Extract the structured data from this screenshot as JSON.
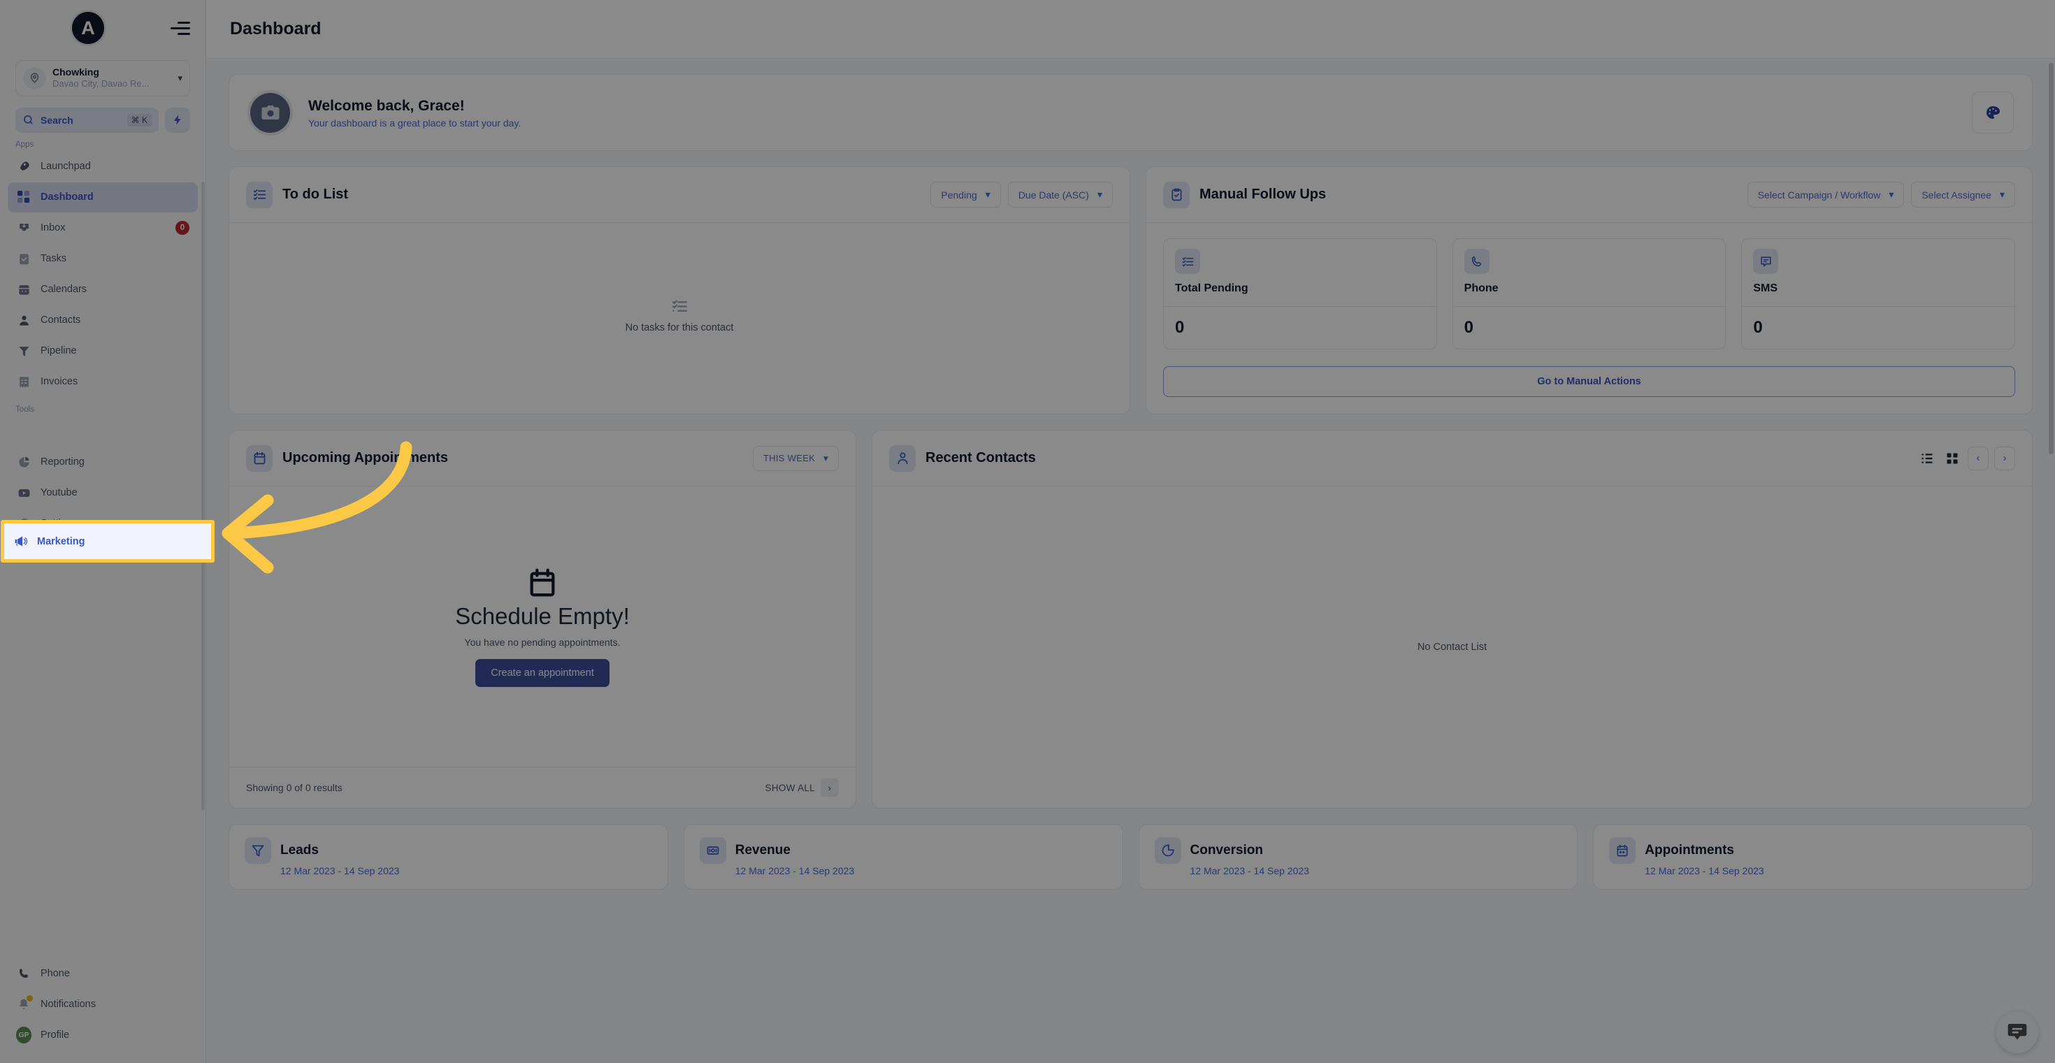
{
  "brand": {
    "logo_letter": "A",
    "accent": "#3b55c4",
    "highlight": "#fbc945"
  },
  "sidebar": {
    "location": {
      "name": "Chowking",
      "subtitle": "Davao City, Davao Re...",
      "icon": "map-pin-icon"
    },
    "search": {
      "label": "Search",
      "shortcut": "⌘ K",
      "icon": "search-icon"
    },
    "quick_action_icon": "lightning-bolt-icon",
    "sections": [
      {
        "label": "Apps",
        "items": [
          {
            "label": "Launchpad",
            "icon": "rocket-icon",
            "active": false
          },
          {
            "label": "Dashboard",
            "icon": "grid-icon",
            "active": true
          },
          {
            "label": "Inbox",
            "icon": "inbox-icon",
            "active": false,
            "badge": "0"
          },
          {
            "label": "Tasks",
            "icon": "clipboard-check-icon",
            "active": false
          },
          {
            "label": "Calendars",
            "icon": "calendar-icon",
            "active": false
          },
          {
            "label": "Contacts",
            "icon": "user-icon",
            "active": false
          },
          {
            "label": "Pipeline",
            "icon": "funnel-icon",
            "active": false
          },
          {
            "label": "Invoices",
            "icon": "receipt-icon",
            "active": false
          }
        ]
      },
      {
        "label": "Tools",
        "items": [
          {
            "label": "Marketing",
            "icon": "megaphone-icon",
            "active": false,
            "highlighted": true
          },
          {
            "label": "Reporting",
            "icon": "pie-chart-icon",
            "active": false
          },
          {
            "label": "Youtube",
            "icon": "youtube-icon",
            "active": false
          },
          {
            "label": "Settings",
            "icon": "gear-icon",
            "active": false
          }
        ]
      }
    ],
    "footer": [
      {
        "label": "Phone",
        "icon": "phone-icon"
      },
      {
        "label": "Notifications",
        "icon": "bell-icon",
        "dot": true
      },
      {
        "label": "Profile",
        "icon": "avatar",
        "initials": "GP"
      }
    ]
  },
  "header": {
    "title": "Dashboard",
    "menu_icon": "hamburger-icon"
  },
  "welcome": {
    "title": "Welcome back, Grace!",
    "subtitle": "Your dashboard is a great place to start your day.",
    "avatar_icon": "camera-icon",
    "theme_button_icon": "palette-icon"
  },
  "todo": {
    "title": "To do List",
    "icon": "checklist-icon",
    "filters": [
      {
        "label": "Pending",
        "icon": "chevron-down-icon"
      },
      {
        "label": "Due Date (ASC)",
        "icon": "chevron-down-icon"
      }
    ],
    "empty_text": "No tasks for this contact",
    "empty_icon": "checklist-icon"
  },
  "follow_ups": {
    "title": "Manual Follow Ups",
    "icon": "clipboard-check-icon",
    "filters": [
      {
        "label": "Select Campaign / Workflow",
        "icon": "chevron-down-icon"
      },
      {
        "label": "Select Assignee",
        "icon": "chevron-down-icon"
      }
    ],
    "stats": [
      {
        "name": "Total Pending",
        "value": "0",
        "icon": "checklist-icon"
      },
      {
        "name": "Phone",
        "value": "0",
        "icon": "phone-icon"
      },
      {
        "name": "SMS",
        "value": "0",
        "icon": "sms-icon"
      }
    ],
    "action_label": "Go to Manual Actions"
  },
  "appointments": {
    "title": "Upcoming Appointments",
    "icon": "calendar-icon",
    "filter": {
      "label": "THIS WEEK",
      "icon": "chevron-down-icon"
    },
    "empty_icon": "calendar-icon",
    "empty_title": "Schedule Empty!",
    "empty_subtitle": "You have no pending appointments.",
    "cta_label": "Create an appointment",
    "results_text": "Showing 0 of 0 results",
    "show_all_label": "SHOW ALL",
    "show_all_icon": "chevron-right-icon"
  },
  "recent_contacts": {
    "title": "Recent Contacts",
    "icon": "user-icon",
    "view_list_icon": "list-view-icon",
    "view_grid_icon": "grid-view-icon",
    "prev_icon": "chevron-left-icon",
    "next_icon": "chevron-right-icon",
    "empty_text": "No Contact List"
  },
  "metrics": [
    {
      "title": "Leads",
      "date_range": "12 Mar 2023 - 14 Sep 2023",
      "icon": "funnel-icon"
    },
    {
      "title": "Revenue",
      "date_range": "12 Mar 2023 - 14 Sep 2023",
      "icon": "money-icon"
    },
    {
      "title": "Conversion",
      "date_range": "12 Mar 2023 - 14 Sep 2023",
      "icon": "pie-chart-icon"
    },
    {
      "title": "Appointments",
      "date_range": "12 Mar 2023 - 14 Sep 2023",
      "icon": "calendar-icon"
    }
  ],
  "chat_widget": {
    "icon": "chat-bubble-icon"
  }
}
